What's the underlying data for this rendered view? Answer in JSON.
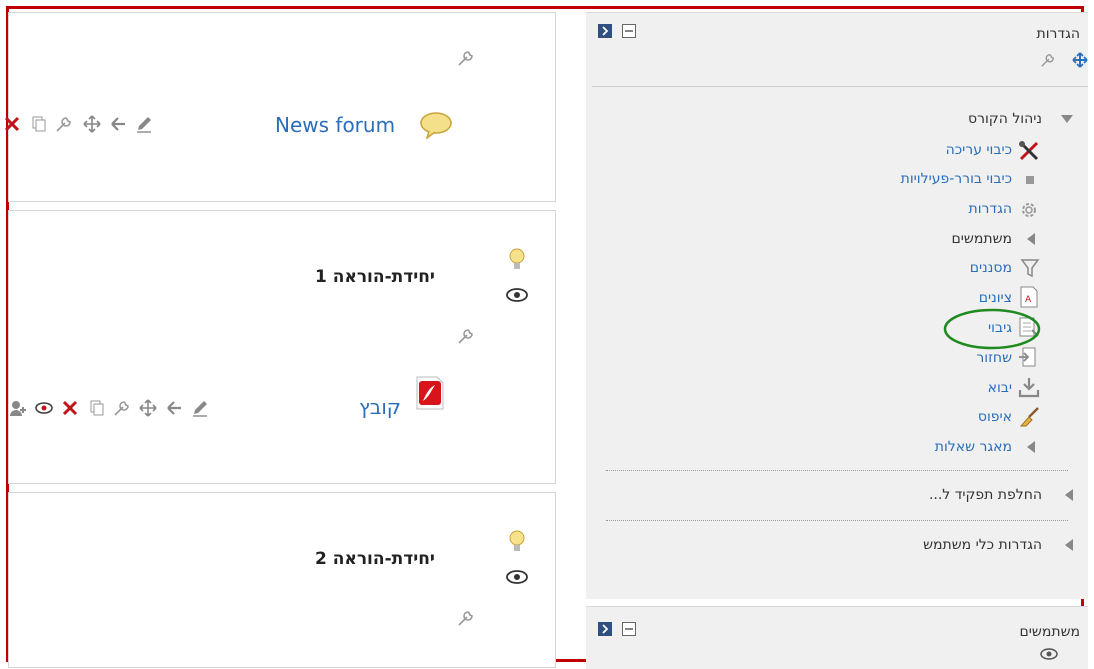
{
  "sections": {
    "general": {
      "activity_label": "News forum"
    },
    "unit1": {
      "title": "יחידת-הוראה 1",
      "activity_label": "קובץ"
    },
    "unit2": {
      "title": "יחידת-הוראה 2"
    }
  },
  "sidebar": {
    "settings_block": {
      "title": "הגדרות",
      "course_admin": {
        "label": "ניהול הקורס",
        "items": [
          {
            "label": "כיבוי עריכה",
            "icon": "edit-tools-icon"
          },
          {
            "label": "כיבוי בורר-פעילויות",
            "icon": "bullet-icon"
          },
          {
            "label": "הגדרות",
            "icon": "gear-icon"
          },
          {
            "label": "משתמשים",
            "icon": "triangle-collapsed-icon"
          },
          {
            "label": "מסננים",
            "icon": "filter-icon"
          },
          {
            "label": "ציונים",
            "icon": "grades-icon"
          },
          {
            "label": "גיבוי",
            "icon": "backup-icon"
          },
          {
            "label": "שחזור",
            "icon": "restore-icon"
          },
          {
            "label": "יבוא",
            "icon": "import-icon"
          },
          {
            "label": "איפוס",
            "icon": "broom-icon"
          },
          {
            "label": "מאגר שאלות",
            "icon": "triangle-collapsed-icon"
          }
        ]
      },
      "switch_role": "החלפת תפקיד ל...",
      "user_settings": "הגדרות כלי משתמש"
    },
    "users_block": {
      "title": "משתמשים"
    }
  },
  "colors": {
    "frame": "#c00000",
    "link": "#2a6ebb",
    "highlight_circle": "#1f8a1f"
  }
}
